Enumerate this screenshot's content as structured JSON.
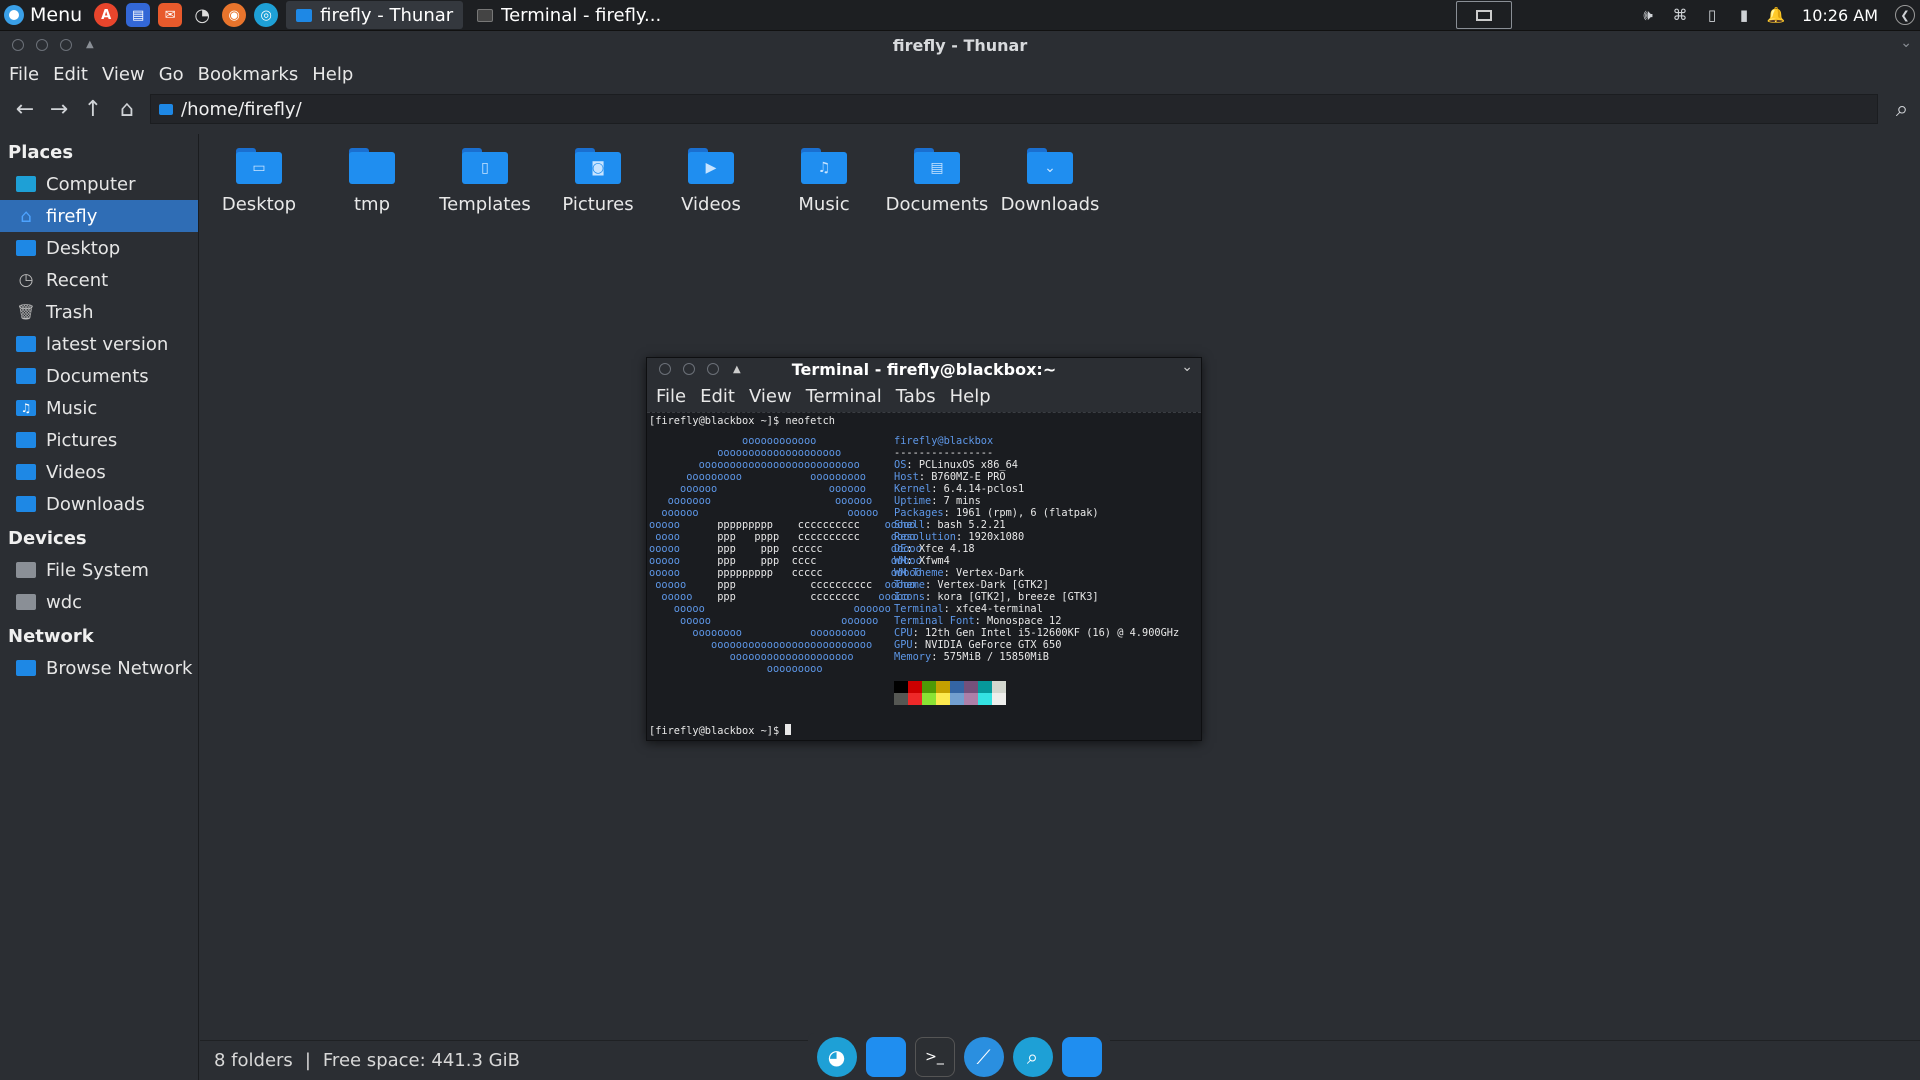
{
  "panel": {
    "menu_label": "Menu",
    "tasks": [
      {
        "label": "firefly - Thunar"
      },
      {
        "label": "Terminal - firefly..."
      }
    ],
    "clock": "10:26 AM"
  },
  "thunar": {
    "title": "firefly - Thunar",
    "menu": [
      "File",
      "Edit",
      "View",
      "Go",
      "Bookmarks",
      "Help"
    ],
    "location": "/home/firefly/",
    "sidebar": {
      "places_header": "Places",
      "places": [
        "Computer",
        "firefly",
        "Desktop",
        "Recent",
        "Trash",
        "latest version",
        "Documents",
        "Music",
        "Pictures",
        "Videos",
        "Downloads"
      ],
      "selected": "firefly",
      "devices_header": "Devices",
      "devices": [
        "File System",
        "wdc"
      ],
      "network_header": "Network",
      "network": [
        "Browse Network"
      ]
    },
    "folders": [
      "Desktop",
      "tmp",
      "Templates",
      "Pictures",
      "Videos",
      "Music",
      "Documents",
      "Downloads"
    ],
    "status": {
      "count": "8 folders",
      "separator": "|",
      "free_space": "Free space: 441.3 GiB"
    }
  },
  "terminal": {
    "title": "Terminal - firefly@blackbox:~",
    "menu": [
      "File",
      "Edit",
      "View",
      "Terminal",
      "Tabs",
      "Help"
    ],
    "prompt_command": "[firefly@blackbox ~]$ neofetch",
    "prompt_end": "[firefly@blackbox ~]$ ",
    "userhost": "firefly@blackbox",
    "underline": "----------------",
    "info": [
      {
        "key": "OS",
        "value": "PCLinuxOS x86_64"
      },
      {
        "key": "Host",
        "value": "B760MZ-E PRO"
      },
      {
        "key": "Kernel",
        "value": "6.4.14-pclos1"
      },
      {
        "key": "Uptime",
        "value": "7 mins"
      },
      {
        "key": "Packages",
        "value": "1961 (rpm), 6 (flatpak)"
      },
      {
        "key": "Shell",
        "value": "bash 5.2.21"
      },
      {
        "key": "Resolution",
        "value": "1920x1080"
      },
      {
        "key": "DE",
        "value": "Xfce 4.18"
      },
      {
        "key": "WM",
        "value": "Xfwm4"
      },
      {
        "key": "WM Theme",
        "value": "Vertex-Dark"
      },
      {
        "key": "Theme",
        "value": "Vertex-Dark [GTK2]"
      },
      {
        "key": "Icons",
        "value": "kora [GTK2], breeze [GTK3]"
      },
      {
        "key": "Terminal",
        "value": "xfce4-terminal"
      },
      {
        "key": "Terminal Font",
        "value": "Monospace 12"
      },
      {
        "key": "CPU",
        "value": "12th Gen Intel i5-12600KF (16) @ 4.900GHz"
      },
      {
        "key": "GPU",
        "value": "NVIDIA GeForce GTX 650"
      },
      {
        "key": "Memory",
        "value": "575MiB / 15850MiB"
      }
    ],
    "palette_row1": [
      "#000000",
      "#cc0000",
      "#4e9a06",
      "#c4a000",
      "#3465a4",
      "#75507b",
      "#06989a",
      "#d3d7cf"
    ],
    "palette_row2": [
      "#555753",
      "#ef2929",
      "#8ae234",
      "#fce94f",
      "#729fcf",
      "#ad7fa8",
      "#34e2e2",
      "#eeeeec"
    ],
    "logo": [
      "               oooooooooooo",
      "           oooooooooooooooooooo",
      "        oooooooooooooooooooooooooo",
      "      ooooooooo           ooooooooo",
      "     oooooo                  oooooo",
      "   ooooooo                    oooooo",
      "  oooooo                        ooooo",
      "ooooo      ppppppppp    cccccccccc    ooooo",
      " oooo      ppp   pppp   cccccccccc     oooo",
      "ooooo      ppp    ppp  ccccc           ooooo",
      "ooooo      ppp    ppp  cccc            ooooo",
      "ooooo      ppppppppp   ccccc           ooooo",
      " ooooo     ppp            cccccccccc  ooooo",
      "  ooooo    ppp            cccccccc   ooooo",
      "    ooooo                        oooooo",
      "     ooooo                     oooooo",
      "       oooooooo           ooooooooo",
      "          oooooooooooooooooooooooooo",
      "             oooooooooooooooooooo",
      "                   ooooooooo"
    ]
  },
  "colors": {
    "accent": "#2f6db5",
    "folder": "#1f8ef0",
    "terminal_blue": "#5d96e6"
  }
}
